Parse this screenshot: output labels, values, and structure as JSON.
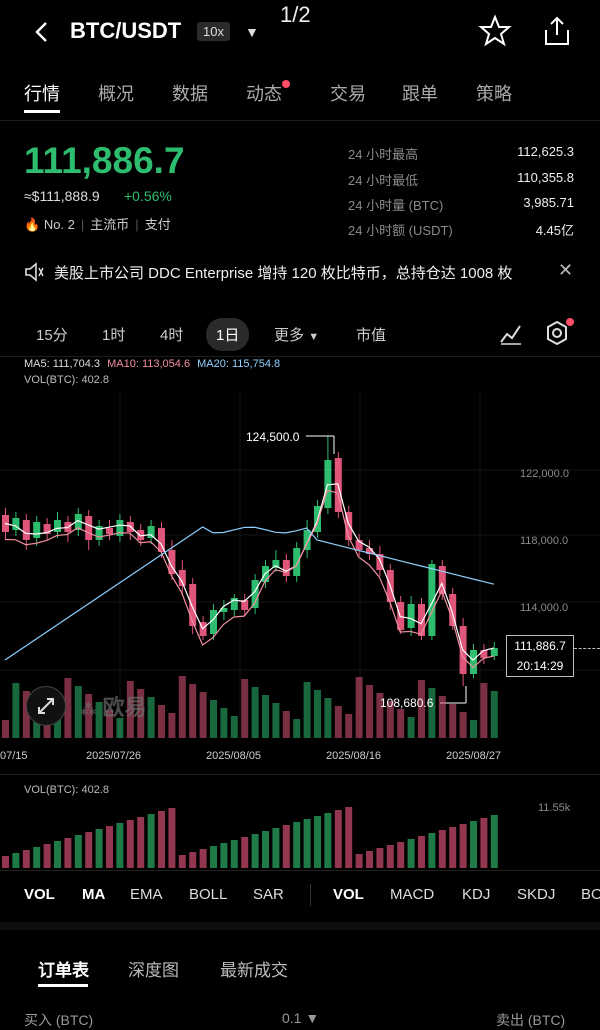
{
  "header": {
    "page_indicator": "1/2",
    "pair": "BTC/USDT",
    "leverage": "10x"
  },
  "tabs": [
    "行情",
    "概况",
    "数据",
    "动态",
    "交易",
    "跟单",
    "策略"
  ],
  "price": {
    "last": "111,886.7",
    "approx": "≈$111,888.9",
    "change": "+0.56%",
    "rank": "No. 2",
    "tag1": "主流币",
    "tag2": "支付"
  },
  "stats": [
    {
      "label": "24 小时最高",
      "value": "112,625.3"
    },
    {
      "label": "24 小时最低",
      "value": "110,355.8"
    },
    {
      "label": "24 小时量 (BTC)",
      "value": "3,985.71"
    },
    {
      "label": "24 小时额 (USDT)",
      "value": "4.45亿"
    }
  ],
  "news": "美股上市公司 DDC Enterprise 增持 120 枚比特币，总持仓达 1008 枚",
  "timeframes": [
    "15分",
    "1时",
    "4时",
    "1日",
    "更多",
    "市值"
  ],
  "ma": {
    "ma5": "MA5: 111,704.3",
    "ma10": "MA10: 113,054.6",
    "ma20": "MA20: 115,754.8",
    "vol": "VOL(BTC): 402.8"
  },
  "colors": {
    "up": "#2ebd6f",
    "down": "#e0557a",
    "ma5": "#ffffff",
    "ma10": "#f08fa0",
    "ma20": "#8fd0ff"
  },
  "chart_data": {
    "type": "candlestick",
    "y_ticks": [
      "122,000.0",
      "118,000.0",
      "114,000.0"
    ],
    "x_dates": [
      "07/15",
      "2025/07/26",
      "2025/08/05",
      "2025/08/16",
      "2025/08/27"
    ],
    "annotations": {
      "high": "124,500.0",
      "low": "108,680.6"
    },
    "current_price": "111,886.7",
    "countdown": "20:14:29",
    "volume_axis_label": "11.55k",
    "watermark": "欧易"
  },
  "lower_panel": {
    "label": "VOL(BTC): 402.8"
  },
  "indicators": [
    "VOL",
    "MA",
    "EMA",
    "BOLL",
    "SAR",
    "VOL",
    "MACD",
    "KDJ",
    "SKDJ",
    "BO"
  ],
  "orderbook_tabs": [
    "订单表",
    "深度图",
    "最新成交"
  ],
  "bottom_row": {
    "left": "买入 (BTC)",
    "mid": "0.1",
    "right": "卖出 (BTC)"
  }
}
